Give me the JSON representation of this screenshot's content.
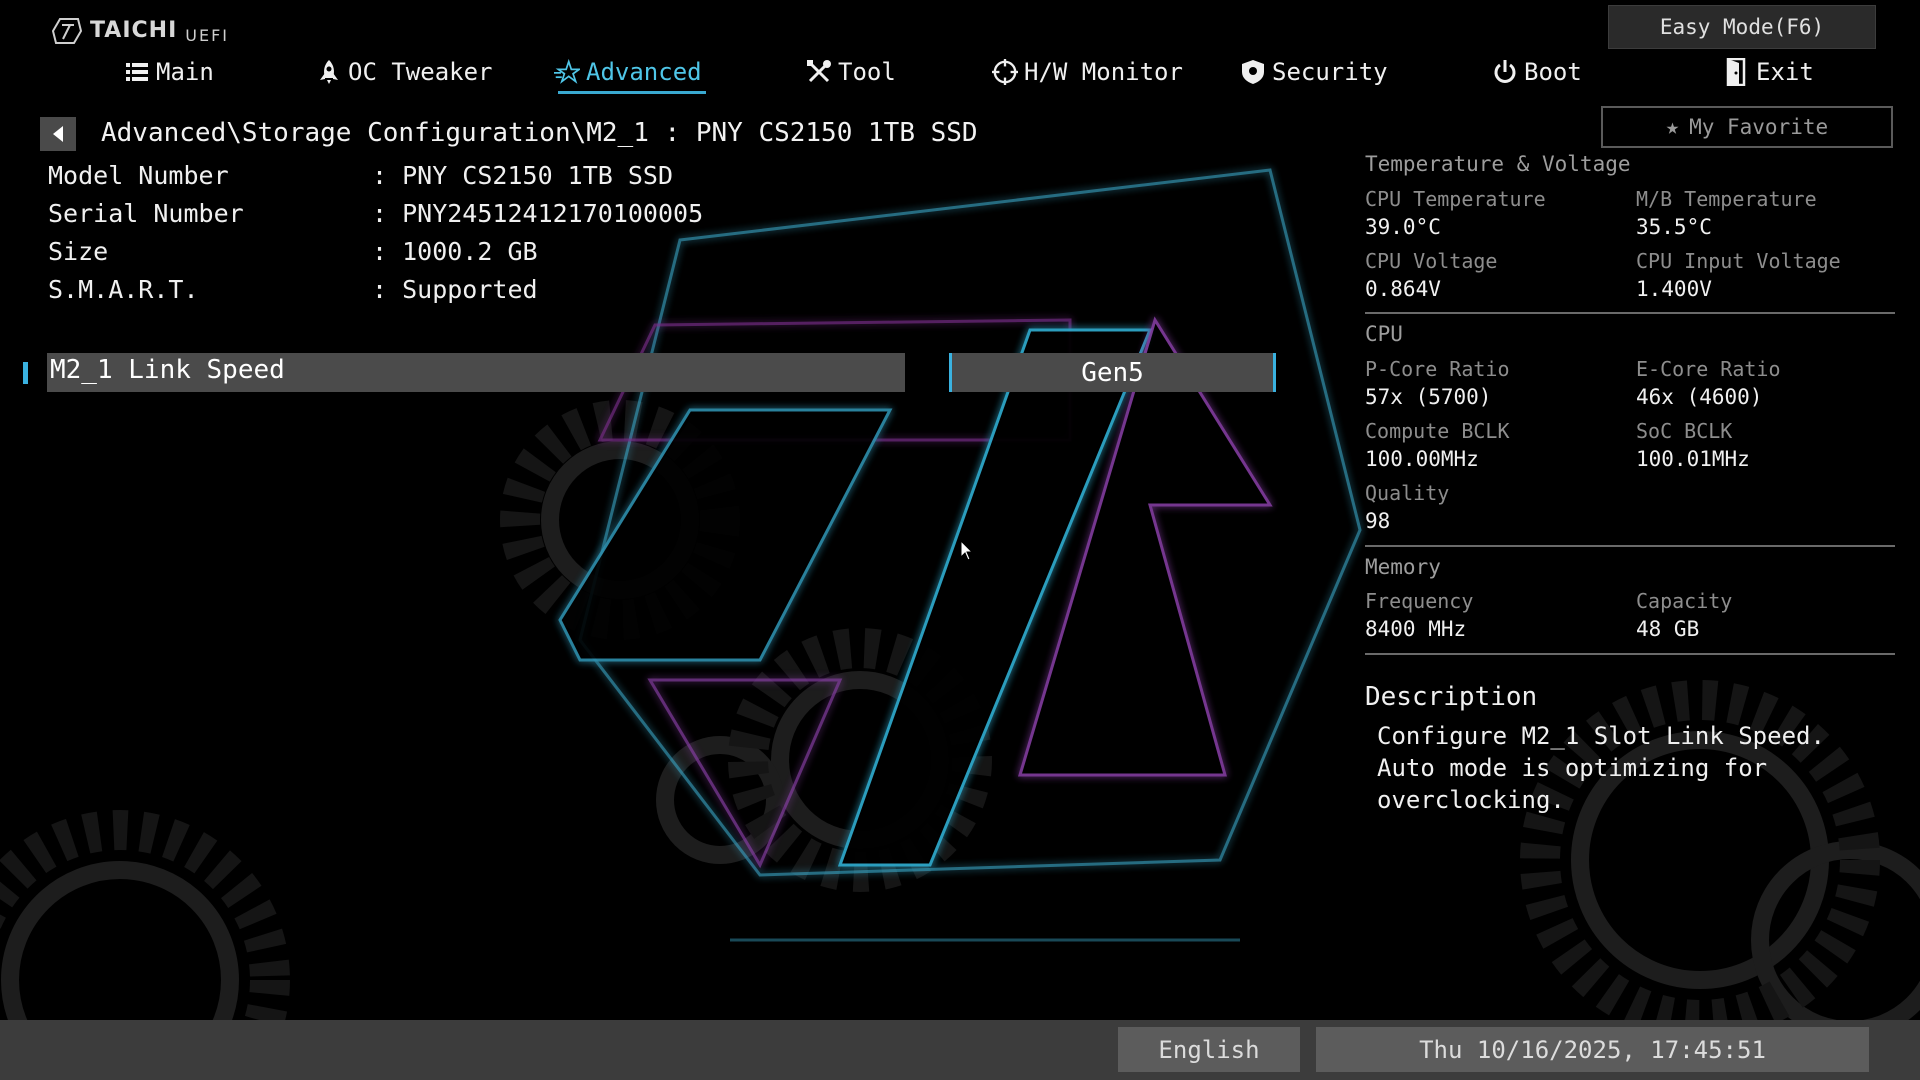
{
  "logo": {
    "brand": "TAICHI",
    "suffix": "UEFI"
  },
  "easy_mode": "Easy Mode(F6)",
  "favorite": "My Favorite",
  "nav": {
    "tabs": [
      {
        "label": "Main",
        "icon": "list-icon",
        "active": false
      },
      {
        "label": "OC Tweaker",
        "icon": "rocket-icon",
        "active": false
      },
      {
        "label": "Advanced",
        "icon": "star-icon",
        "active": true
      },
      {
        "label": "Tool",
        "icon": "tools-icon",
        "active": false
      },
      {
        "label": "H/W Monitor",
        "icon": "monitor-icon",
        "active": false
      },
      {
        "label": "Security",
        "icon": "shield-icon",
        "active": false
      },
      {
        "label": "Boot",
        "icon": "power-icon",
        "active": false
      },
      {
        "label": "Exit",
        "icon": "exit-door-icon",
        "active": false
      }
    ]
  },
  "breadcrumb": "Advanced\\Storage Configuration\\M2_1 : PNY CS2150 1TB SSD",
  "info": [
    {
      "label": "Model Number",
      "value": ": PNY CS2150 1TB SSD"
    },
    {
      "label": "Serial Number",
      "value": ": PNY24512412170100005"
    },
    {
      "label": "Size",
      "value": ": 1000.2 GB"
    },
    {
      "label": "S.M.A.R.T.",
      "value": ": Supported"
    }
  ],
  "setting": {
    "label": "M2_1 Link Speed",
    "value": "Gen5"
  },
  "panel": {
    "temp_voltage": {
      "title": "Temperature & Voltage",
      "cpu_temp_label": "CPU Temperature",
      "cpu_temp": "39.0°C",
      "mb_temp_label": "M/B Temperature",
      "mb_temp": "35.5°C",
      "cpu_volt_label": "CPU Voltage",
      "cpu_volt": "0.864V",
      "cpu_in_volt_label": "CPU Input Voltage",
      "cpu_in_volt": "1.400V"
    },
    "cpu": {
      "title": "CPU",
      "pcore_label": "P-Core Ratio",
      "pcore": "57x (5700)",
      "ecore_label": "E-Core Ratio",
      "ecore": "46x (4600)",
      "bclk_label": "Compute BCLK",
      "bclk": "100.00MHz",
      "soc_label": "SoC BCLK",
      "soc": "100.01MHz",
      "quality_label": "Quality",
      "quality": "98"
    },
    "memory": {
      "title": "Memory",
      "freq_label": "Frequency",
      "freq": "8400 MHz",
      "cap_label": "Capacity",
      "cap": "48 GB"
    }
  },
  "description": {
    "title": "Description",
    "text": "Configure M2_1 Slot Link Speed. Auto mode is optimizing for overclocking."
  },
  "status": {
    "language": "English",
    "datetime": "Thu 10/16/2025, 17:45:51"
  },
  "colors": {
    "accent": "#3ab2e0",
    "active_tab": "#4fc6e8",
    "magenta_glow": "#b040c0"
  }
}
